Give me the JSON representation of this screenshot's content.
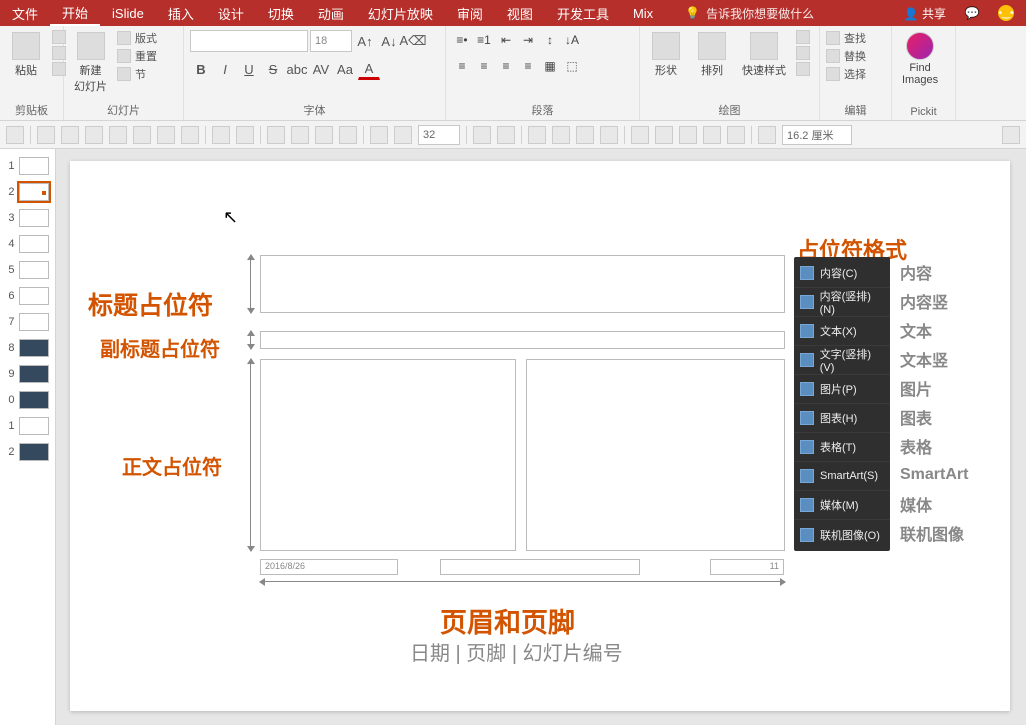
{
  "titlebar": {
    "tabs": [
      "文件",
      "开始",
      "iSlide",
      "插入",
      "设计",
      "切换",
      "动画",
      "幻灯片放映",
      "审阅",
      "视图",
      "开发工具",
      "Mix"
    ],
    "active_index": 1,
    "tell_me": "告诉我你想要做什么",
    "share": "共享"
  },
  "ribbon": {
    "clipboard": {
      "paste": "粘贴",
      "label": "剪贴板"
    },
    "slides": {
      "new_slide": "新建\n幻灯片",
      "layout": "版式",
      "reset": "重置",
      "section": "节",
      "label": "幻灯片"
    },
    "font": {
      "size_placeholder": "18",
      "label": "字体"
    },
    "paragraph": {
      "label": "段落"
    },
    "drawing": {
      "shapes": "形状",
      "arrange": "排列",
      "quick_styles": "快速样式",
      "label": "绘图"
    },
    "editing": {
      "find": "查找",
      "replace": "替换",
      "select": "选择",
      "label": "编辑"
    },
    "pickit": {
      "find_images": "Find\nImages",
      "label": "Pickit"
    }
  },
  "toolbar2": {
    "num": "32",
    "size": "16.2 厘米"
  },
  "thumbnails": {
    "items": [
      {
        "n": "1",
        "dark": false
      },
      {
        "n": "2",
        "dark": false,
        "sel": true,
        "dot": true
      },
      {
        "n": "3",
        "dark": false
      },
      {
        "n": "4",
        "dark": false
      },
      {
        "n": "5",
        "dark": false
      },
      {
        "n": "6",
        "dark": false
      },
      {
        "n": "7",
        "dark": false
      },
      {
        "n": "8",
        "dark": true
      },
      {
        "n": "9",
        "dark": true
      },
      {
        "n": "0",
        "dark": true
      },
      {
        "n": "1",
        "dark": false
      },
      {
        "n": "2",
        "dark": true
      }
    ]
  },
  "slide": {
    "anno": {
      "format_title": "占位符格式",
      "title": "标题占位符",
      "subtitle": "副标题占位符",
      "body": "正文占位符",
      "hf_title": "页眉和页脚",
      "hf_sub": "日期 | 页脚 | 幻灯片编号"
    },
    "date": "2016/8/26",
    "page_num": "11",
    "format_menu": [
      {
        "label": "内容(C)",
        "right": "内容"
      },
      {
        "label": "内容(竖排)(N)",
        "right": "内容竖"
      },
      {
        "label": "文本(X)",
        "right": "文本"
      },
      {
        "label": "文字(竖排)(V)",
        "right": "文本竖"
      },
      {
        "label": "图片(P)",
        "right": "图片"
      },
      {
        "label": "图表(H)",
        "right": "图表"
      },
      {
        "label": "表格(T)",
        "right": "表格"
      },
      {
        "label": "SmartArt(S)",
        "right": "SmartArt"
      },
      {
        "label": "媒体(M)",
        "right": "媒体"
      },
      {
        "label": "联机图像(O)",
        "right": "联机图像"
      }
    ]
  }
}
